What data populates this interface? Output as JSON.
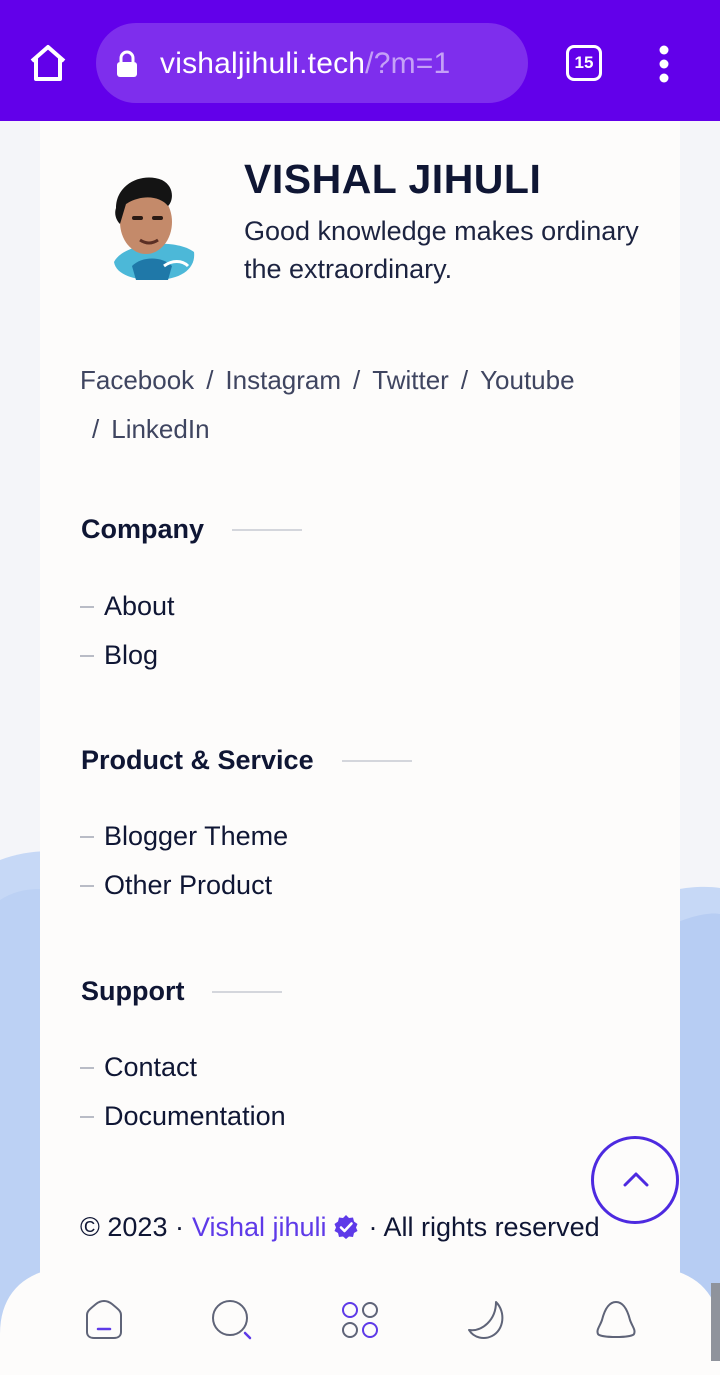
{
  "browser": {
    "url_domain": "vishaljihuli.tech",
    "url_path": "/?m=1",
    "tab_count": "15",
    "bar_color": "#6200ea"
  },
  "author": {
    "name": "VISHAL JIHULI",
    "tagline": "Good knowledge makes ordinary the extraordinary."
  },
  "social": {
    "links": [
      "Facebook",
      "Instagram",
      "Twitter",
      "Youtube",
      "LinkedIn"
    ],
    "separator": "/"
  },
  "sections": [
    {
      "title": "Company",
      "items": [
        "About",
        "Blog"
      ]
    },
    {
      "title": "Product & Service",
      "items": [
        "Blogger Theme",
        "Other Product"
      ]
    },
    {
      "title": "Support",
      "items": [
        "Contact",
        "Documentation"
      ]
    }
  ],
  "footer": {
    "copyright": "© 2023 ·",
    "owner": "Vishal jihuli",
    "rights": "· All rights reserved"
  },
  "bottom_nav": {
    "icons": [
      "home-icon",
      "search-icon",
      "apps-icon",
      "dark-mode-icon",
      "notification-icon"
    ]
  },
  "colors": {
    "accent": "#5e3ae8",
    "scroll_button_border": "#4d2ae0"
  }
}
